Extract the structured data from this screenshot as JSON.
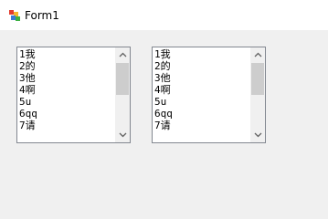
{
  "window": {
    "title": "Form1"
  },
  "listboxes": [
    {
      "items": [
        "1我",
        "2的",
        "3他",
        "4啊",
        "5u",
        "6qq",
        "7请"
      ]
    },
    {
      "items": [
        "1我",
        "2的",
        "3他",
        "4啊",
        "5u",
        "6qq",
        "7请"
      ]
    }
  ],
  "icons": {
    "app": "form-app-icon",
    "scroll_up": "chevron-up-icon",
    "scroll_down": "chevron-down-icon"
  },
  "colors": {
    "listbox_border": "#828790",
    "scroll_thumb": "#cdcdcd",
    "window_bg": "#f0f0f0"
  }
}
